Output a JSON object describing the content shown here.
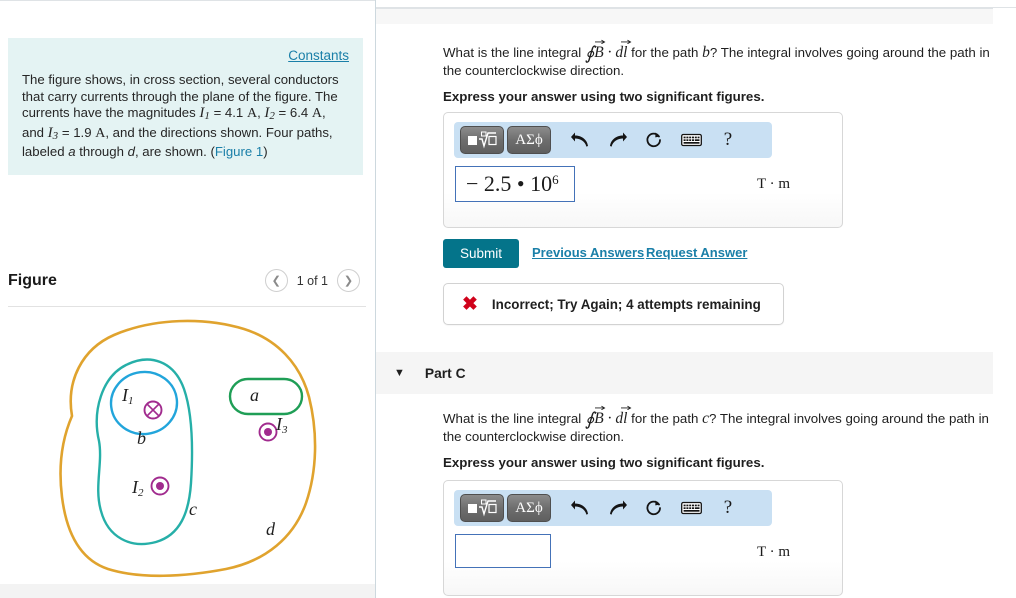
{
  "left": {
    "constants_link": "Constants",
    "problem": {
      "line1": "The figure shows, in cross section, several conductors",
      "line2": "that carry currents through the plane of the figure. The",
      "line3_pre": "currents have the magnitudes ",
      "i1_sym": "I",
      "i1_sub": "1",
      "i1_eq": " = 4.1 ",
      "i1_unit": "A",
      "i2_sym": "I",
      "i2_sub": "2",
      "i2_eq": " = 6.4 ",
      "i2_unit": "A",
      "line4_pre": "and ",
      "i3_sym": "I",
      "i3_sub": "3",
      "i3_eq": " = 1.9 ",
      "i3_unit": "A",
      "line4_post": ", and the directions shown. Four paths,",
      "line5_pre": "labeled ",
      "label_a": "a",
      "line5_mid": " through ",
      "label_d": "d",
      "line5_post": ", are shown. (",
      "figure_link": "Figure 1",
      "line5_end": ")"
    },
    "figure": {
      "title": "Figure",
      "prev_icon": "chevron-left-icon",
      "next_icon": "chevron-right-icon",
      "count": "1 of 1",
      "labels": {
        "a": "a",
        "b": "b",
        "c": "c",
        "d": "d",
        "i1": "I",
        "i1_sub": "1",
        "i2": "I",
        "i2_sub": "2",
        "i3": "I",
        "i3_sub": "3"
      },
      "colors": {
        "path_a": "#1f9e56",
        "path_b": "#22a5db",
        "path_c": "#26afa8",
        "path_d": "#e0a32e",
        "current_symbol": "#a12b8e"
      },
      "current_markers": {
        "i1_direction": "into-page-cross-icon",
        "i2_direction": "out-of-page-dot-icon",
        "i3_direction": "out-of-page-dot-icon"
      }
    }
  },
  "right": {
    "part_b": {
      "question_pre": "What is the line integral ",
      "integral_oint": "∮",
      "integral_b": "B",
      "integral_dot": " · ",
      "integral_dl": "dl",
      "question_mid": " for the path ",
      "path_letter": "b",
      "question_post": "? The integral involves going around the path in the counterclockwise direction.",
      "sig_fig_instruction": "Express your answer using two significant figures.",
      "toolbar": {
        "template_button": "template-math-icon",
        "greek_button": "ΑΣϕ",
        "undo_icon": "undo-arrow-icon",
        "redo_icon": "redo-arrow-icon",
        "reset_icon": "reset-circular-arrow-icon",
        "keyboard_icon": "keyboard-icon",
        "help_icon": "?"
      },
      "answer_value": "− 2.5 • 10",
      "answer_exponent": "6",
      "answer_placeholder": "",
      "unit": "T · m",
      "submit_label": "Submit",
      "previous_answers_label": "Previous Answers",
      "request_answer_label": "Request Answer",
      "feedback_icon": "✖",
      "feedback_text": "Incorrect; Try Again; 4 attempts remaining"
    },
    "part_c": {
      "caret_icon": "caret-down-icon",
      "header_label": "Part C",
      "question_pre": "What is the line integral ",
      "integral_oint": "∮",
      "integral_b": "B",
      "integral_dot": " · ",
      "integral_dl": "dl",
      "question_mid": " for the path ",
      "path_letter": "c",
      "question_post": "? The integral involves going around the path in the counterclockwise direction.",
      "sig_fig_instruction": "Express your answer using two significant figures.",
      "toolbar": {
        "template_button": "template-math-icon",
        "greek_button": "ΑΣϕ",
        "undo_icon": "undo-arrow-icon",
        "redo_icon": "redo-arrow-icon",
        "reset_icon": "reset-circular-arrow-icon",
        "keyboard_icon": "keyboard-icon",
        "help_icon": "?"
      },
      "answer_value": "",
      "answer_placeholder": "",
      "unit": "T · m"
    }
  }
}
